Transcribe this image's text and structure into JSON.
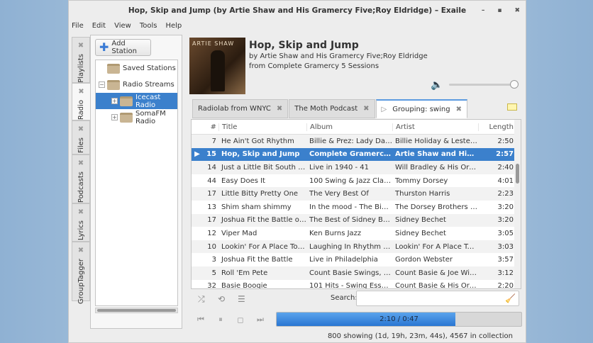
{
  "window": {
    "title": "Hop, Skip and Jump (by Artie Shaw and His Gramercy Five;Roy Eldridge) – Exaile",
    "buttons": [
      "–",
      "▪",
      "✖"
    ]
  },
  "menu": [
    "File",
    "Edit",
    "View",
    "Tools",
    "Help"
  ],
  "side_tabs": [
    {
      "label": "Playlists",
      "h": 65
    },
    {
      "label": "Radio",
      "h": 53,
      "active": true
    },
    {
      "label": "Files",
      "h": 48
    },
    {
      "label": "Podcasts",
      "h": 69
    },
    {
      "label": "Lyrics",
      "h": 54
    },
    {
      "label": "GroupTagger",
      "h": 84
    }
  ],
  "radio": {
    "add_station": "Add Station",
    "tree": [
      {
        "label": "Saved Stations",
        "level": 0,
        "expander": ""
      },
      {
        "label": "Radio Streams",
        "level": 0,
        "expander": "−"
      },
      {
        "label": "Icecast Radio",
        "level": 1,
        "expander": "+",
        "selected": true
      },
      {
        "label": "SomaFM Radio",
        "level": 1,
        "expander": "+"
      }
    ]
  },
  "now_playing": {
    "title": "Hop, Skip and Jump",
    "by": "by Artie Shaw and His Gramercy Five;Roy Eldridge",
    "from": "from Complete Gramercy 5 Sessions",
    "album_art_text": "ARTIE SHAW",
    "volume": 1.0
  },
  "tabs": [
    {
      "label": "Radiolab from WNYC"
    },
    {
      "label": "The Moth Podcast"
    },
    {
      "label": "Grouping: swing",
      "active": true,
      "icon": "play-icon"
    }
  ],
  "columns": {
    "num": "#",
    "title": "Title",
    "album": "Album",
    "artist": "Artist",
    "length": "Length"
  },
  "tracks": [
    [
      "7",
      "He Ain't Got Rhythm",
      "Billie & Prez: Lady Day & …",
      "Billie Holiday & Lester Young",
      "2:50"
    ],
    [
      "15",
      "Hop, Skip and Jump",
      "Complete Gramercy 5 Ses…",
      "Artie Shaw and His Gram…",
      "2:57"
    ],
    [
      "14",
      "Just a Little Bit South of …",
      "Live in 1940 - 41",
      "Will Bradley & His Orchestra",
      "2:40"
    ],
    [
      "44",
      "Easy Does It",
      "100 Swing & Jazz Classics",
      "Tommy Dorsey",
      "4:01"
    ],
    [
      "17",
      "Little Bitty Pretty One",
      "The Very Best Of",
      "Thurston Harris",
      "2:23"
    ],
    [
      "13",
      "Shim sham shimmy",
      "In the mood - The Big Ban…",
      "The Dorsey Brothers Orch…",
      "3:20"
    ],
    [
      "17",
      "Joshua Fit the Battle of J…",
      "The Best of Sidney Bechet…",
      "Sidney Bechet",
      "3:20"
    ],
    [
      "12",
      "Viper Mad",
      "Ken Burns Jazz",
      "Sidney Bechet",
      "3:05"
    ],
    [
      "10",
      "Lookin' For A Place To Park",
      "Laughing In Rhythm - Disc…",
      "Lookin' For A Place To Park",
      "3:03"
    ],
    [
      "3",
      "Joshua Fit the Battle",
      "Live in Philadelphia",
      "Gordon Webster",
      "3:57"
    ],
    [
      "5",
      "Roll 'Em Pete",
      "Count Basie Swings, Joe …",
      "Count Basie & Joe Williams",
      "3:12"
    ],
    [
      "32",
      "Basie Boogie",
      "101 Hits - Swing Essentials",
      "Count Basie & His Orchestra",
      "2:20"
    ]
  ],
  "playing_index": 1,
  "search": {
    "label": "Search:",
    "value": ""
  },
  "player": {
    "time": "2:10 / 0:47",
    "progress_percent": 73
  },
  "status": "800 showing (1d, 19h, 23m, 44s), 4567 in collection",
  "colors": {
    "accent": "#3b80cc",
    "progress": "#2a76d2"
  }
}
